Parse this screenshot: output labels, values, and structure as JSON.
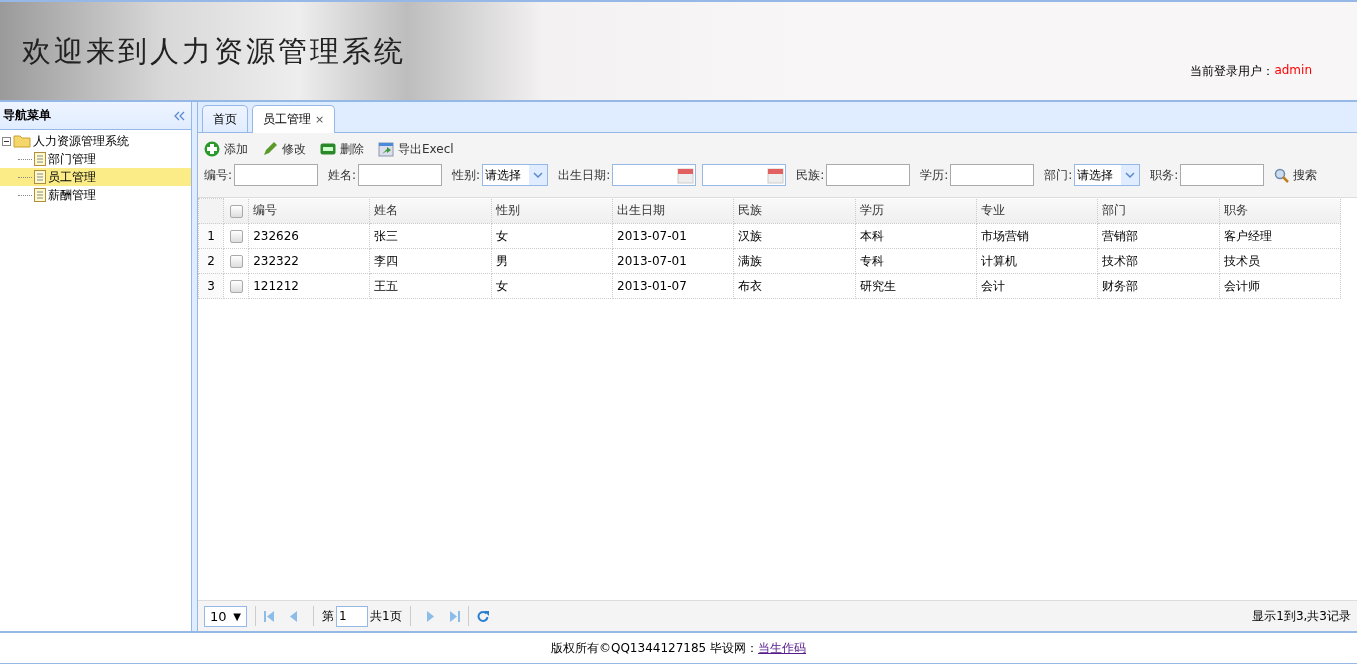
{
  "header": {
    "title": "欢迎来到人力资源管理系统",
    "user_label": "当前登录用户：",
    "user_name": "admin"
  },
  "sidebar": {
    "title": "导航菜单",
    "tree": [
      {
        "label": "人力资源管理系统",
        "expanded": true,
        "selected": false,
        "children": [
          {
            "label": "部门管理",
            "selected": false
          },
          {
            "label": "员工管理",
            "selected": true
          },
          {
            "label": "薪酬管理",
            "selected": false
          }
        ]
      }
    ]
  },
  "tabs": [
    {
      "label": "首页",
      "selected": false
    },
    {
      "label": "员工管理",
      "selected": true,
      "close": "×"
    }
  ],
  "toolbar": [
    {
      "kind": "add",
      "label": "添加"
    },
    {
      "kind": "edit",
      "label": "修改"
    },
    {
      "kind": "delete",
      "label": "删除"
    },
    {
      "kind": "export",
      "label": "导出Execl"
    }
  ],
  "filters": [
    {
      "kind": "text",
      "label": "编号:"
    },
    {
      "kind": "text",
      "label": "姓名:"
    },
    {
      "kind": "select",
      "label": "性别:",
      "value": "请选择"
    },
    {
      "kind": "daterange",
      "label": "出生日期:"
    },
    {
      "kind": "text",
      "label": "民族:"
    },
    {
      "kind": "text",
      "label": "学历:"
    },
    {
      "kind": "select",
      "label": "部门:",
      "value": "请选择"
    },
    {
      "kind": "text",
      "label": "职务:"
    }
  ],
  "search_button": "搜索",
  "table": {
    "header_checked": false,
    "columns": [
      "编号",
      "姓名",
      "性别",
      "出生日期",
      "民族",
      "学历",
      "专业",
      "部门",
      "职务"
    ],
    "rows": [
      {
        "number": "1",
        "checked": false,
        "cells": [
          "232626",
          "张三",
          "女",
          "2013-07-01",
          "汉族",
          "本科",
          "市场营销",
          "营销部",
          "客户经理"
        ]
      },
      {
        "number": "2",
        "checked": false,
        "cells": [
          "232322",
          "李四",
          "男",
          "2013-07-01",
          "满族",
          "专科",
          "计算机",
          "技术部",
          "技术员"
        ]
      },
      {
        "number": "3",
        "checked": false,
        "cells": [
          "121212",
          "王五",
          "女",
          "2013-01-07",
          "布衣",
          "研究生",
          "会计",
          "财务部",
          "会计师"
        ]
      }
    ]
  },
  "pager": {
    "page_size": "10",
    "page_size_arrow": "▼",
    "page_prefix": "第",
    "page": "1",
    "page_total": "共1页",
    "summary": "显示1到3,共3记录"
  },
  "footer": {
    "text": "版权所有©QQ1344127185 毕设网：",
    "link": "当生作码"
  }
}
